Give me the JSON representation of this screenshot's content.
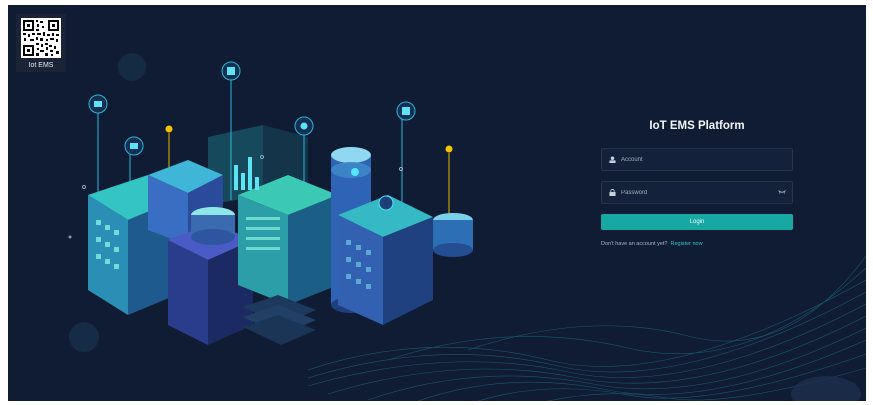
{
  "qr": {
    "label": "Iot EMS",
    "icon": "qr-code-icon"
  },
  "login": {
    "title": "IoT EMS Platform",
    "account_placeholder": "Account",
    "password_placeholder": "Password",
    "login_label": "Login",
    "register_prompt": "Don't have an account yet?",
    "register_link": "Register now"
  },
  "colors": {
    "background": "#0f1c33",
    "accent": "#17a8a2",
    "link": "#2fc4c0",
    "title": "#f2f6fb"
  }
}
